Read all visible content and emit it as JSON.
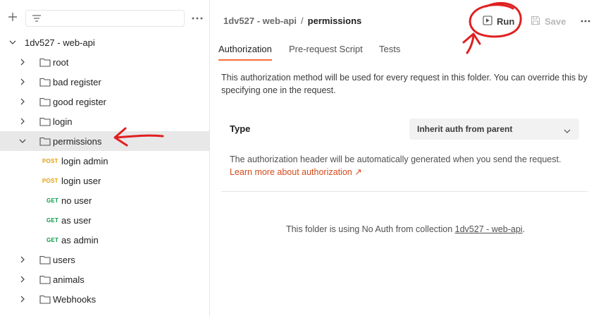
{
  "sidebar": {
    "search_placeholder": "",
    "tree": [
      {
        "kind": "collection",
        "label": "1dv527 - web-api",
        "expanded": true
      },
      {
        "kind": "folder",
        "label": "root"
      },
      {
        "kind": "folder",
        "label": "bad register"
      },
      {
        "kind": "folder",
        "label": "good register"
      },
      {
        "kind": "folder",
        "label": "login"
      },
      {
        "kind": "folder",
        "label": "permissions",
        "expanded": true,
        "selected": true
      },
      {
        "kind": "request",
        "method": "POST",
        "label": "login admin"
      },
      {
        "kind": "request",
        "method": "POST",
        "label": "login user"
      },
      {
        "kind": "request",
        "method": "GET",
        "label": "no user"
      },
      {
        "kind": "request",
        "method": "GET",
        "label": "as user"
      },
      {
        "kind": "request",
        "method": "GET",
        "label": "as admin"
      },
      {
        "kind": "folder",
        "label": "users"
      },
      {
        "kind": "folder",
        "label": "animals"
      },
      {
        "kind": "folder",
        "label": "Webhooks"
      }
    ]
  },
  "header": {
    "breadcrumb_parent": "1dv527 - web-api",
    "breadcrumb_sep": "/",
    "breadcrumb_current": "permissions",
    "run_label": "Run",
    "save_label": "Save"
  },
  "tabs": [
    {
      "label": "Authorization",
      "active": true
    },
    {
      "label": "Pre-request Script",
      "active": false
    },
    {
      "label": "Tests",
      "active": false
    }
  ],
  "auth": {
    "description": "This authorization method will be used for every request in this folder. You can override this by specifying one in the request.",
    "type_label": "Type",
    "type_value": "Inherit auth from parent",
    "inherit_note": "The authorization header will be automatically generated when you send the request.",
    "learn_more": "Learn more about authorization ↗",
    "noauth_prefix": "This folder is using No Auth from collection ",
    "noauth_collection": "1dv527 - web-api",
    "noauth_suffix": "."
  },
  "colors": {
    "accent": "#ff6c37",
    "post": "#e5a000",
    "get": "#0a9a4a",
    "annotation": "#e02020"
  }
}
